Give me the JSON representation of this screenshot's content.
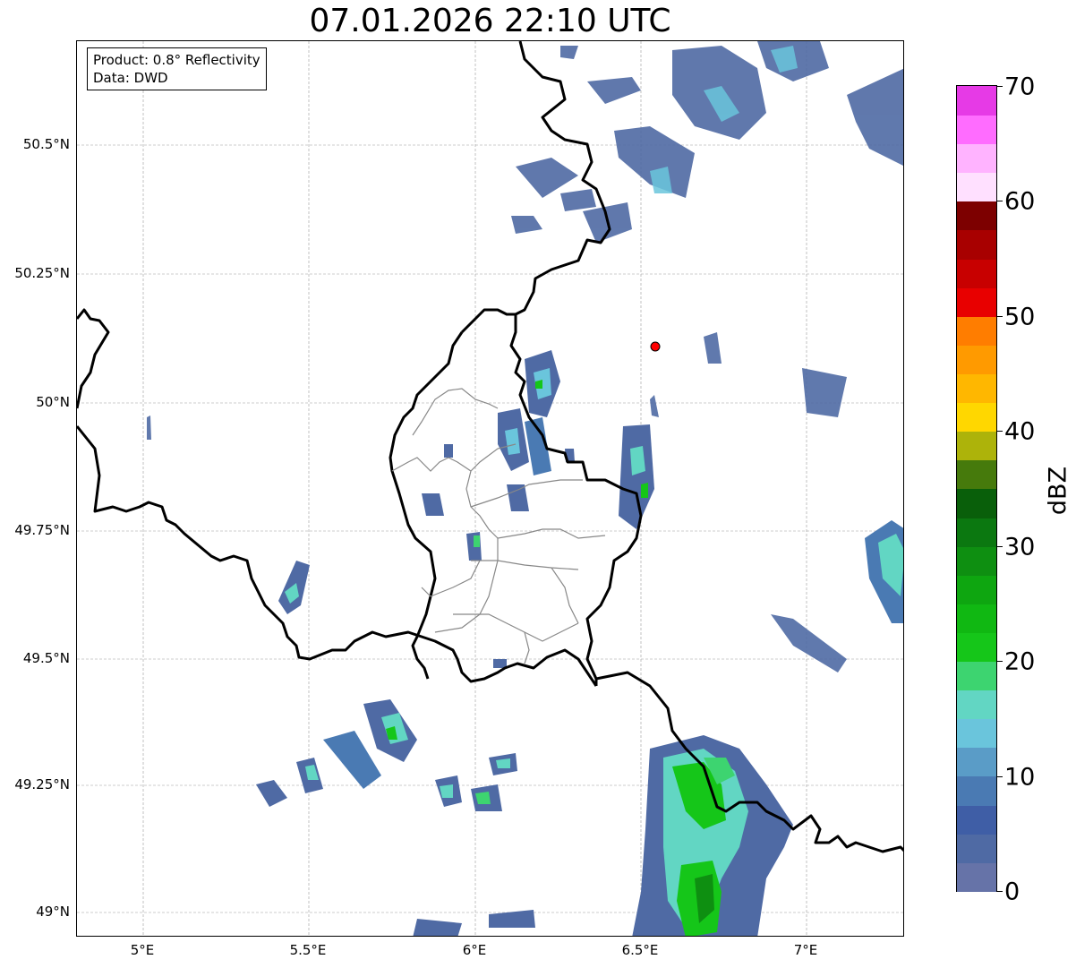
{
  "title": "07.01.2026 22:10 UTC",
  "info": {
    "product": "Product: 0.8° Reflectivity",
    "data": "Data: DWD"
  },
  "axes": {
    "lat_ticks": [
      "50.5°N",
      "50.25°N",
      "50°N",
      "49.75°N",
      "49.5°N",
      "49.25°N",
      "49°N"
    ],
    "lon_ticks": [
      "5°E",
      "5.5°E",
      "6°E",
      "6.5°E",
      "7°E"
    ]
  },
  "colorbar": {
    "label": "dBZ",
    "ticks": [
      "0",
      "10",
      "20",
      "30",
      "40",
      "50",
      "60",
      "70"
    ],
    "colors": [
      "#6673a8",
      "#4f6aa4",
      "#3f5ea6",
      "#4a7ab3",
      "#5a9cc7",
      "#6ac5dc",
      "#62d6c3",
      "#3dd470",
      "#15c619",
      "#10b812",
      "#0ea610",
      "#0e8f11",
      "#0b7810",
      "#095f0a",
      "#467a0c",
      "#adb30a",
      "#ffd700",
      "#ffb700",
      "#ff9a00",
      "#ff7d00",
      "#e80000",
      "#c80000",
      "#a80000",
      "#7d0000",
      "#ffe0ff",
      "#ffb3ff",
      "#ff6cff",
      "#e63ae6"
    ]
  },
  "marker": {
    "name": "radar-site",
    "color": "#ff0000"
  }
}
